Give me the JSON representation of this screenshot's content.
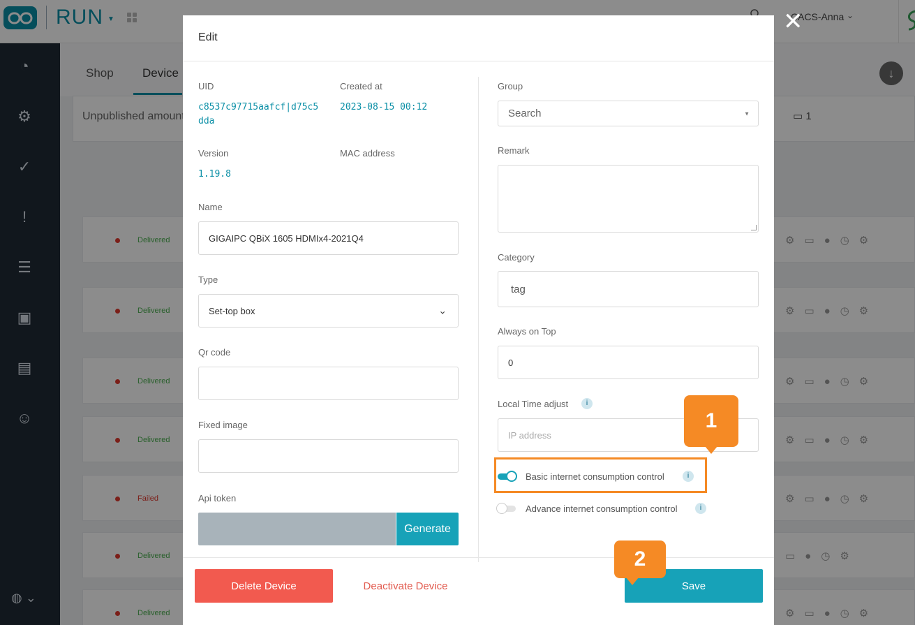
{
  "app": {
    "name": "RUN",
    "user_name": "CACS-Anna"
  },
  "background": {
    "tabs": [
      "Shop",
      "Device"
    ],
    "unpublished_label": "Unpublished amount",
    "device_count": "1",
    "rows": [
      {
        "status": "Delivered",
        "status_color": "#4caf50"
      },
      {
        "status": "Delivered",
        "status_color": "#4caf50"
      },
      {
        "status": "Delivered",
        "status_color": "#4caf50"
      },
      {
        "status": "Delivered",
        "status_color": "#4caf50"
      },
      {
        "status": "Failed",
        "status_color": "#e03a2f"
      },
      {
        "status": "Delivered",
        "status_color": "#4caf50"
      },
      {
        "status": "Delivered",
        "status_color": "#4caf50"
      }
    ]
  },
  "modal": {
    "title": "Edit",
    "uid_label": "UID",
    "uid_value_line1": "c8537c97715aafcf|d75c5",
    "uid_value_line2": "dda",
    "created_label": "Created at",
    "created_value": "2023-08-15 00:12",
    "version_label": "Version",
    "version_value": "1.19.8",
    "mac_label": "MAC address",
    "name_label": "Name",
    "name_value": "GIGAIPC QBiX 1605 HDMIx4-2021Q4",
    "type_label": "Type",
    "type_value": "Set-top box",
    "qr_label": "Qr code",
    "fixed_image_label": "Fixed image",
    "api_token_label": "Api token",
    "generate_label": "Generate",
    "group_label": "Group",
    "group_placeholder": "Search",
    "remark_label": "Remark",
    "category_label": "Category",
    "category_value": "tag",
    "always_on_top_label": "Always on Top",
    "always_on_top_value": "0",
    "local_time_label": "Local Time adjust",
    "ip_placeholder": "IP address",
    "basic_toggle_label": "Basic internet consumption control",
    "advance_toggle_label": "Advance internet consumption control",
    "delete_label": "Delete Device",
    "deactivate_label": "Deactivate Device",
    "save_label": "Save",
    "info_glyph": "i"
  },
  "annotations": {
    "step1": "1",
    "step2": "2"
  },
  "colors": {
    "accent": "#17a2b8",
    "danger": "#f25a4f",
    "annotation": "#f58a25"
  }
}
